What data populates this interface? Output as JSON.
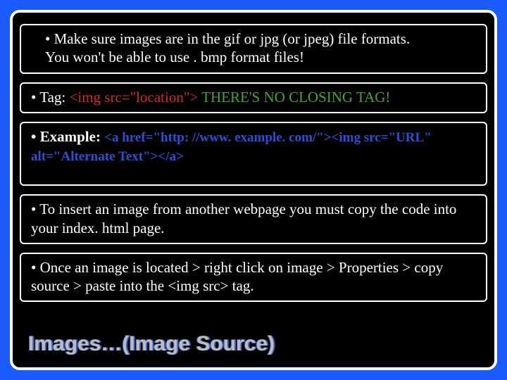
{
  "slide": {
    "title": "Images…(Image Source)",
    "bullets": {
      "b1": {
        "line1": "Make sure images are in the gif or jpg (or jpeg) file formats.",
        "line2": "You won't be able to use . bmp format files!"
      },
      "b2": {
        "label": "Tag: ",
        "code": "<img src=\"location\">",
        "tail": " THERE'S NO CLOSING TAG!"
      },
      "b3": {
        "label": "Example: ",
        "code_part1": "<a href=\"http: //www. example. com/\"><img src=\"URL\"",
        "code_part2": "alt=\"Alternate Text\"></a>"
      },
      "b4": "To insert an image from another webpage you must copy the code into your index. html page.",
      "b5": "Once an image is located > right click on image > Properties > copy source > paste into the <img src> tag."
    }
  }
}
